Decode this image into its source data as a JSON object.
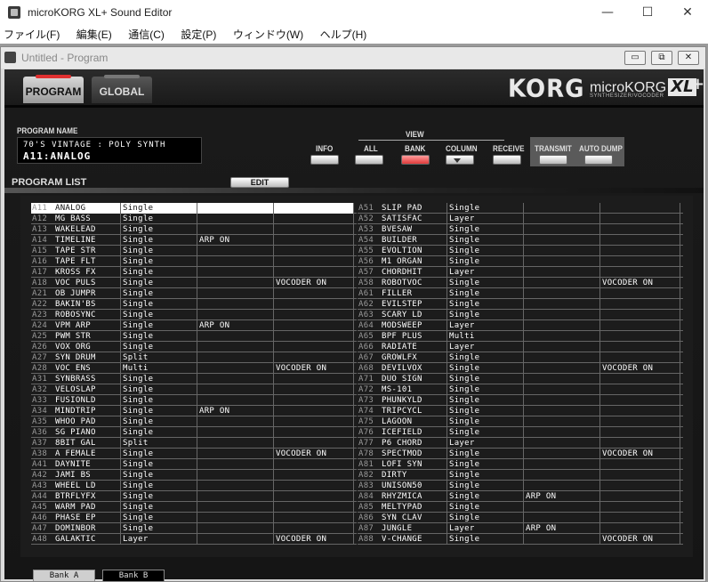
{
  "window": {
    "title": "microKORG XL+ Sound Editor",
    "min": "—",
    "max": "☐",
    "close": "✕"
  },
  "menu": [
    "ファイル(F)",
    "編集(E)",
    "通信(C)",
    "設定(P)",
    "ウィンドウ(W)",
    "ヘルプ(H)"
  ],
  "child": {
    "title": "Untitled - Program",
    "min": "▭",
    "restore": "⧉",
    "close": "✕"
  },
  "tabs": {
    "program": "PROGRAM",
    "global": "GLOBAL"
  },
  "brand": {
    "korg": "KORG",
    "model": "microKORG",
    "xl": "XL",
    "plus": "+",
    "sub": "SYNTHESIZER/VOCODER"
  },
  "program_name": {
    "label": "PROGRAM NAME",
    "line1": "70'S VINTAGE : POLY SYNTH",
    "line2": "A11:ANALOG"
  },
  "buttons": {
    "edit": "EDIT",
    "info": "INFO",
    "view": "VIEW",
    "all": "ALL",
    "bank": "BANK",
    "column": "COLUMN",
    "receive": "RECEIVE",
    "transmit": "TRANSMIT",
    "auto_dump": "AUTO DUMP"
  },
  "program_list": {
    "title": "PROGRAM LIST",
    "left": [
      [
        "A11",
        "ANALOG",
        "Single",
        "",
        ""
      ],
      [
        "A12",
        "MG BASS",
        "Single",
        "",
        ""
      ],
      [
        "A13",
        "WAKELEAD",
        "Single",
        "",
        ""
      ],
      [
        "A14",
        "TIMELINE",
        "Single",
        "ARP ON",
        ""
      ],
      [
        "A15",
        "TAPE STR",
        "Single",
        "",
        ""
      ],
      [
        "A16",
        "TAPE FLT",
        "Single",
        "",
        ""
      ],
      [
        "A17",
        "KROSS FX",
        "Single",
        "",
        ""
      ],
      [
        "A18",
        "VOC PULS",
        "Single",
        "",
        "VOCODER ON"
      ],
      [
        "A21",
        "OB JUMPR",
        "Single",
        "",
        ""
      ],
      [
        "A22",
        "BAKIN'BS",
        "Single",
        "",
        ""
      ],
      [
        "A23",
        "ROBOSYNC",
        "Single",
        "",
        ""
      ],
      [
        "A24",
        "VPM ARP",
        "Single",
        "ARP ON",
        ""
      ],
      [
        "A25",
        "PWM STR",
        "Single",
        "",
        ""
      ],
      [
        "A26",
        "VOX ORG",
        "Single",
        "",
        ""
      ],
      [
        "A27",
        "SYN DRUM",
        "Split",
        "",
        ""
      ],
      [
        "A28",
        "VOC ENS",
        "Multi",
        "",
        "VOCODER ON"
      ],
      [
        "A31",
        "SYNBRASS",
        "Single",
        "",
        ""
      ],
      [
        "A32",
        "VELOSLAP",
        "Single",
        "",
        ""
      ],
      [
        "A33",
        "FUSIONLD",
        "Single",
        "",
        ""
      ],
      [
        "A34",
        "MINDTRIP",
        "Single",
        "ARP ON",
        ""
      ],
      [
        "A35",
        "WHOO PAD",
        "Single",
        "",
        ""
      ],
      [
        "A36",
        "SG PIANO",
        "Single",
        "",
        ""
      ],
      [
        "A37",
        "8BIT GAL",
        "Split",
        "",
        ""
      ],
      [
        "A38",
        "A FEMALE",
        "Single",
        "",
        "VOCODER ON"
      ],
      [
        "A41",
        "DAYNITE",
        "Single",
        "",
        ""
      ],
      [
        "A42",
        "JAMI BS",
        "Single",
        "",
        ""
      ],
      [
        "A43",
        "WHEEL LD",
        "Single",
        "",
        ""
      ],
      [
        "A44",
        "BTRFLYFX",
        "Single",
        "",
        ""
      ],
      [
        "A45",
        "WARM PAD",
        "Single",
        "",
        ""
      ],
      [
        "A46",
        "PHASE EP",
        "Single",
        "",
        ""
      ],
      [
        "A47",
        "DOMINBOR",
        "Single",
        "",
        ""
      ],
      [
        "A48",
        "GALAKTIC",
        "Layer",
        "",
        "VOCODER ON"
      ]
    ],
    "right": [
      [
        "A51",
        "SLIP PAD",
        "Single",
        "",
        ""
      ],
      [
        "A52",
        "SATISFAC",
        "Layer",
        "",
        ""
      ],
      [
        "A53",
        "BVESAW",
        "Single",
        "",
        ""
      ],
      [
        "A54",
        "BUILDER",
        "Single",
        "",
        ""
      ],
      [
        "A55",
        "EVOLTION",
        "Single",
        "",
        ""
      ],
      [
        "A56",
        "M1 ORGAN",
        "Single",
        "",
        ""
      ],
      [
        "A57",
        "CHORDHIT",
        "Layer",
        "",
        ""
      ],
      [
        "A58",
        "ROBOTVOC",
        "Single",
        "",
        "VOCODER ON"
      ],
      [
        "A61",
        "FILLER",
        "Single",
        "",
        ""
      ],
      [
        "A62",
        "EVILSTEP",
        "Single",
        "",
        ""
      ],
      [
        "A63",
        "SCARY LD",
        "Single",
        "",
        ""
      ],
      [
        "A64",
        "MODSWEEP",
        "Layer",
        "",
        ""
      ],
      [
        "A65",
        "BPF PLUS",
        "Multi",
        "",
        ""
      ],
      [
        "A66",
        "RADIATE",
        "Layer",
        "",
        ""
      ],
      [
        "A67",
        "GROWLFX",
        "Single",
        "",
        ""
      ],
      [
        "A68",
        "DEVILVOX",
        "Single",
        "",
        "VOCODER ON"
      ],
      [
        "A71",
        "DUO SIGN",
        "Single",
        "",
        ""
      ],
      [
        "A72",
        "MS-101",
        "Single",
        "",
        ""
      ],
      [
        "A73",
        "PHUNKYLD",
        "Single",
        "",
        ""
      ],
      [
        "A74",
        "TRIPCYCL",
        "Single",
        "",
        ""
      ],
      [
        "A75",
        "LAGOON",
        "Single",
        "",
        ""
      ],
      [
        "A76",
        "ICEFIELD",
        "Single",
        "",
        ""
      ],
      [
        "A77",
        "P6 CHORD",
        "Layer",
        "",
        ""
      ],
      [
        "A78",
        "SPECTMOD",
        "Single",
        "",
        "VOCODER ON"
      ],
      [
        "A81",
        "LOFI SYN",
        "Single",
        "",
        ""
      ],
      [
        "A82",
        "DIRTY",
        "Single",
        "",
        ""
      ],
      [
        "A83",
        "UNISON50",
        "Single",
        "",
        ""
      ],
      [
        "A84",
        "RHYZMICA",
        "Single",
        "ARP ON",
        ""
      ],
      [
        "A85",
        "MELTYPAD",
        "Single",
        "",
        ""
      ],
      [
        "A86",
        "SYN CLAV",
        "Single",
        "",
        ""
      ],
      [
        "A87",
        "JUNGLE",
        "Layer",
        "ARP ON",
        ""
      ],
      [
        "A88",
        "V-CHANGE",
        "Single",
        "",
        "VOCODER ON"
      ]
    ],
    "selected": "A11"
  },
  "bank_tabs": {
    "a": "Bank A",
    "b": "Bank B"
  },
  "colors": {
    "bank_active": "#e84848",
    "program_led": "#e03030"
  }
}
